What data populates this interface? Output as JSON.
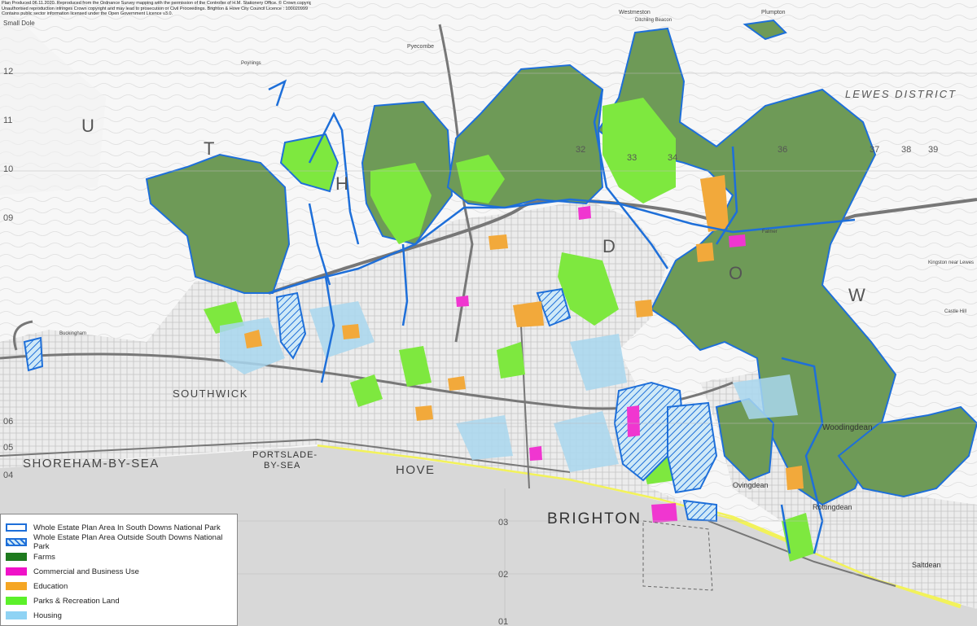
{
  "copyright_lines": [
    "Plan Produced 06.11.2020. Reproduced from the Ordnance Survey mapping with the permission of the Controller of H.M. Stationery Office. © Crown copyright.",
    "Unauthorised reproduction infringes Crown copyright and may lead to prosecution or Civil Proceedings. Brighton & Hove City Council Licence : 100020999",
    "Contains public sector information licensed under the Open Government Licence v3.0."
  ],
  "places": {
    "shoreham": "SHOREHAM-BY-SEA",
    "southwick": "SOUTHWICK",
    "portslade1": "PORTSLADE-",
    "portslade2": "BY-SEA",
    "hove": "HOVE",
    "brighton": "BRIGHTON",
    "lewes": "LEWES DISTRICT",
    "woodingdean": "Woodingdean",
    "ovingdean": "Ovingdean",
    "rottingdean": "Rottingdean",
    "saltdean": "Saltdean",
    "buckingham": "Buckingham",
    "pyecombe": "Pyecombe",
    "westmeston": "Westmeston",
    "plumpton": "Plumpton",
    "kingston": "Kingston near Lewes",
    "small_dole": "Small Dole",
    "poynings": "Poynings",
    "ditchling_beacon": "Ditchling Beacon",
    "falmer": "Falmer",
    "castle_hill": "Castle Hill"
  },
  "grid_labels": {
    "n12": "12",
    "n11": "11",
    "n10": "10",
    "n09": "09",
    "n06": "06",
    "n05": "05",
    "n04": "04",
    "n03": "03",
    "n02": "02",
    "n01": "01",
    "e37": "37",
    "e38": "38",
    "e39": "39",
    "e32": "32",
    "e33": "33",
    "e34": "34",
    "e36": "36"
  },
  "big_letters": [
    "U",
    "T",
    "H",
    "D",
    "O",
    "W"
  ],
  "legend": {
    "items": [
      {
        "label": "Whole Estate Plan Area In South Downs National Park",
        "kind": "outline",
        "color": "#1e6fd9"
      },
      {
        "label": "Whole Estate Plan Area Outside South Downs National Park",
        "kind": "hatch",
        "color": "#1e6fd9"
      },
      {
        "label": "Farms",
        "kind": "fill",
        "color": "#1e7a1e"
      },
      {
        "label": "Commercial and Business Use",
        "kind": "fill",
        "color": "#f012c8"
      },
      {
        "label": "Education",
        "kind": "fill",
        "color": "#f5a623"
      },
      {
        "label": "Parks & Recreation Land",
        "kind": "fill",
        "color": "#5cf02a"
      },
      {
        "label": "Housing",
        "kind": "fill",
        "color": "#8fd3f4"
      }
    ]
  },
  "colors": {
    "farm": "#6e9a57",
    "park": "#7ee83f",
    "education": "#f2a93b",
    "housing": "#a9d7ef",
    "commercial": "#f036d0",
    "boundary": "#1e6fd9",
    "sea": "#d8d8d8",
    "beach": "#f2f25a"
  }
}
